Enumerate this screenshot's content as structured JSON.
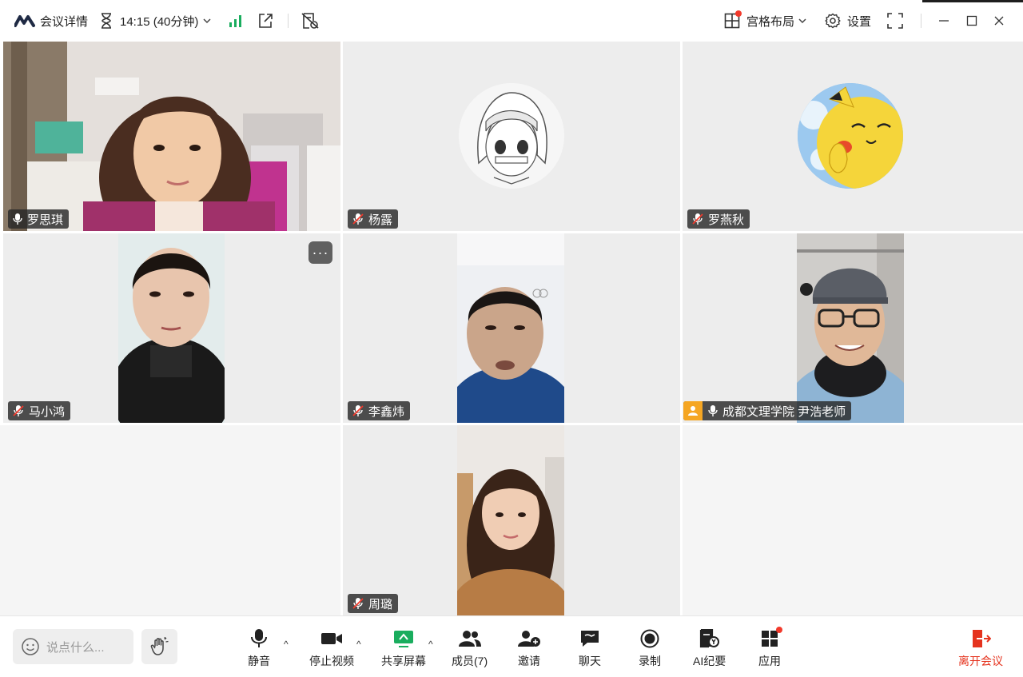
{
  "topbar": {
    "meeting_details": "会议详情",
    "timer": "14:15 (40分钟)",
    "layout_label": "宫格布局",
    "settings_label": "设置"
  },
  "participants": [
    {
      "name": "罗思琪",
      "mic": "on"
    },
    {
      "name": "杨露",
      "mic": "muted"
    },
    {
      "name": "罗燕秋",
      "mic": "muted"
    },
    {
      "name": "马小鸿",
      "mic": "muted"
    },
    {
      "name": "李鑫炜",
      "mic": "muted"
    },
    {
      "name": "成都文理学院 尹浩老师",
      "mic": "on",
      "host": true
    },
    {
      "name": "周璐",
      "mic": "muted"
    }
  ],
  "more_button": "···",
  "toolbar": {
    "chat_placeholder": "说点什么...",
    "mute": "静音",
    "stop_video": "停止视频",
    "share_screen": "共享屏幕",
    "members": "成员(7)",
    "invite": "邀请",
    "chat": "聊天",
    "record": "录制",
    "ai_summary": "AI纪要",
    "apps": "应用",
    "leave": "离开会议"
  },
  "colors": {
    "accent_green": "#1aad5e",
    "leave_red": "#e5331e",
    "notification_red": "#f2392b",
    "host_badge": "#f5a623"
  }
}
